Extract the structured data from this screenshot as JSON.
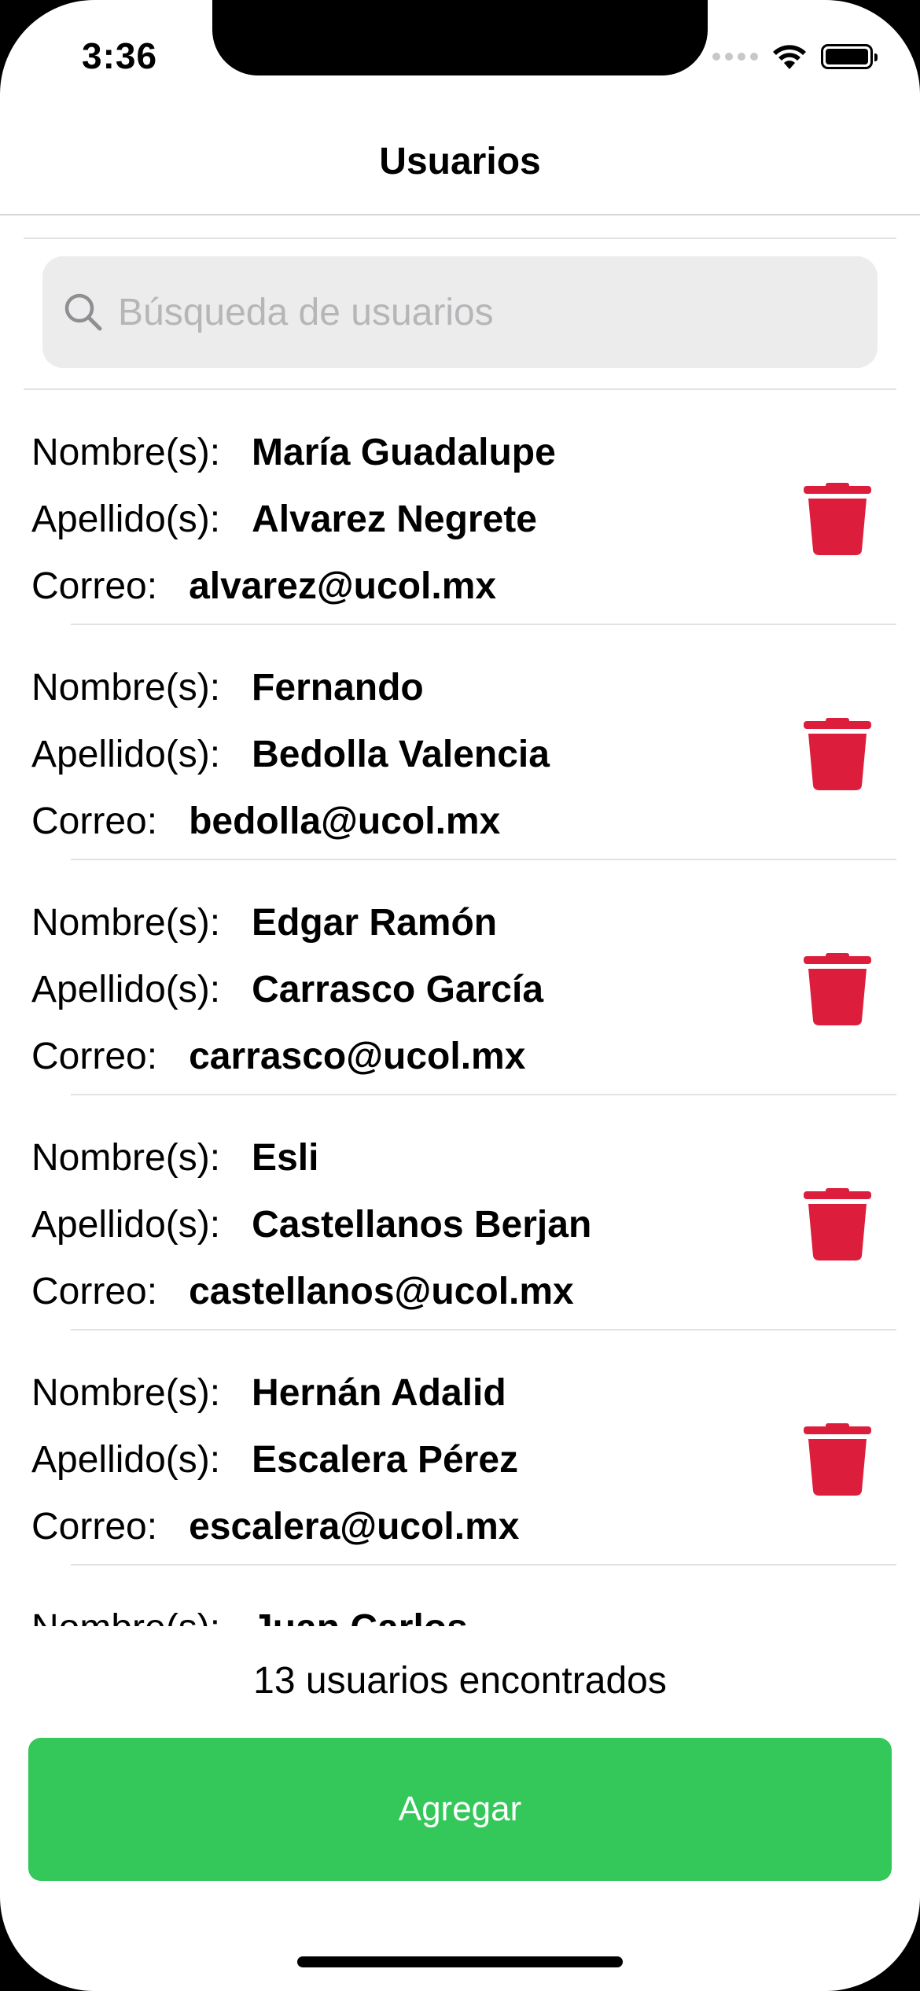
{
  "status": {
    "time": "3:36"
  },
  "nav": {
    "title": "Usuarios"
  },
  "search": {
    "placeholder": "Búsqueda de usuarios",
    "value": ""
  },
  "labels": {
    "nombre": "Nombre(s):",
    "apellido": "Apellido(s):",
    "correo": "Correo:"
  },
  "users": [
    {
      "nombre": "María Guadalupe",
      "apellido": "Alvarez Negrete",
      "correo": "alvarez@ucol.mx"
    },
    {
      "nombre": "Fernando",
      "apellido": "Bedolla Valencia",
      "correo": "bedolla@ucol.mx"
    },
    {
      "nombre": "Edgar Ramón",
      "apellido": "Carrasco García",
      "correo": "carrasco@ucol.mx"
    },
    {
      "nombre": "Esli",
      "apellido": "Castellanos Berjan",
      "correo": "castellanos@ucol.mx"
    },
    {
      "nombre": "Hernán Adalid",
      "apellido": "Escalera Pérez",
      "correo": "escalera@ucol.mx"
    },
    {
      "nombre": "Juan Carlos",
      "apellido": "",
      "correo": ""
    }
  ],
  "footer": {
    "count_text": "13 usuarios encontrados",
    "add_label": "Agregar"
  },
  "colors": {
    "delete": "#dc1e3c",
    "add": "#34c759"
  },
  "icons": {
    "search": "search-icon",
    "delete": "trash-icon",
    "wifi": "wifi-icon",
    "battery": "battery-icon"
  }
}
